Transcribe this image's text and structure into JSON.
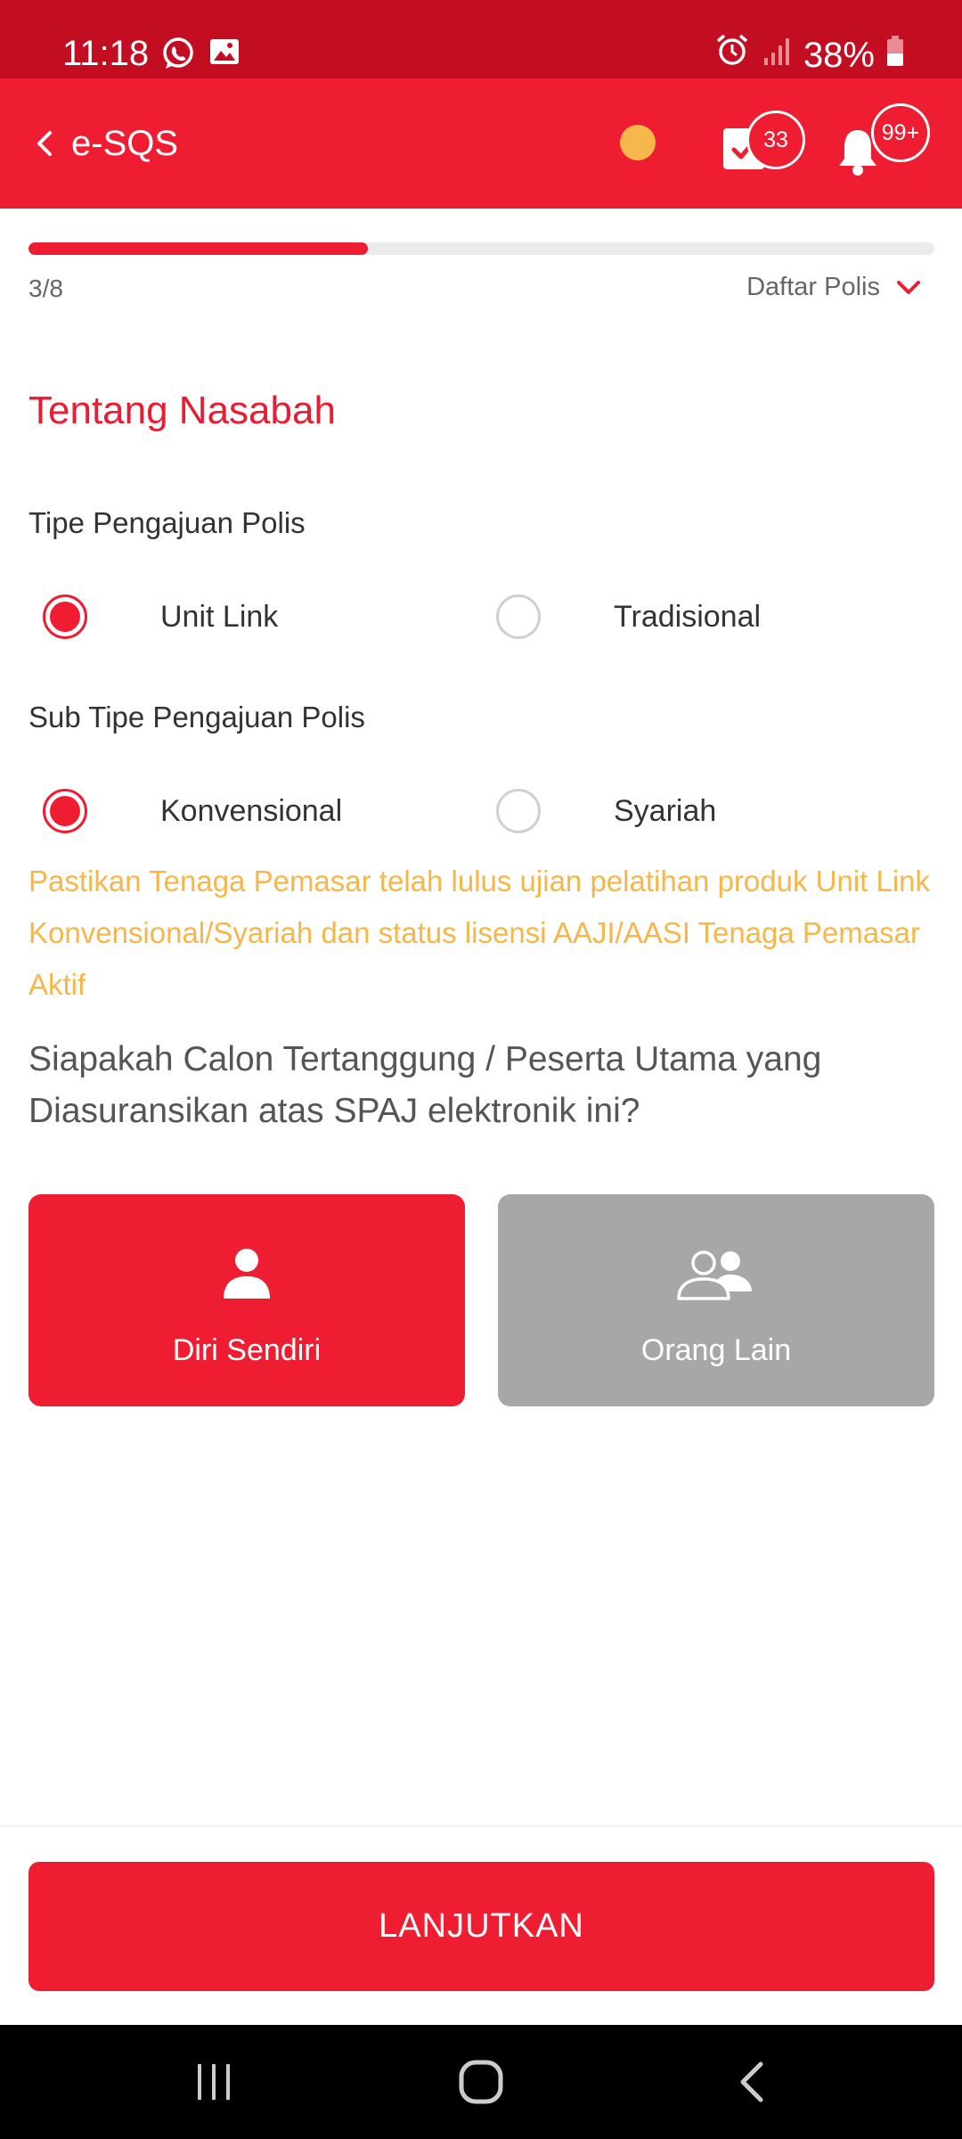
{
  "status_bar": {
    "time": "11:18",
    "battery": "38%",
    "icons": [
      "whatsapp-icon",
      "gallery-icon",
      "alarm-icon",
      "signal-icon",
      "battery-icon"
    ]
  },
  "app_bar": {
    "title": "e-SQS",
    "tasks_badge": "33",
    "notifications_badge": "99+",
    "status_dot_color": "#f7b84b"
  },
  "progress": {
    "step": "3/8",
    "fraction": 0.375,
    "policy_list_label": "Daftar Polis"
  },
  "form": {
    "section_title": "Tentang Nasabah",
    "policy_type": {
      "label": "Tipe Pengajuan Polis",
      "options": [
        {
          "label": "Unit Link",
          "selected": true
        },
        {
          "label": "Tradisional",
          "selected": false
        }
      ]
    },
    "policy_subtype": {
      "label": "Sub Tipe Pengajuan Polis",
      "options": [
        {
          "label": "Konvensional",
          "selected": true
        },
        {
          "label": "Syariah",
          "selected": false
        }
      ]
    },
    "notice": "Pastikan Tenaga Pemasar telah lulus ujian pelatihan produk Unit Link Konvensional/Syariah dan status lisensi AAJI/AASI Tenaga Pemasar Aktif",
    "question": "Siapakah Calon Tertanggung / Peserta Utama yang Diasuransikan atas SPAJ elektronik ini?",
    "insured_choices": [
      {
        "label": "Diri Sendiri",
        "icon": "person-icon",
        "selected": true
      },
      {
        "label": "Orang Lain",
        "icon": "people-icon",
        "selected": false
      }
    ]
  },
  "footer": {
    "continue_label": "LANJUTKAN"
  },
  "colors": {
    "brand_red": "#ee1d32",
    "status_bar_red": "#c30d21",
    "warning_text": "#f6b64a",
    "inactive_card": "#a6a7a9"
  }
}
